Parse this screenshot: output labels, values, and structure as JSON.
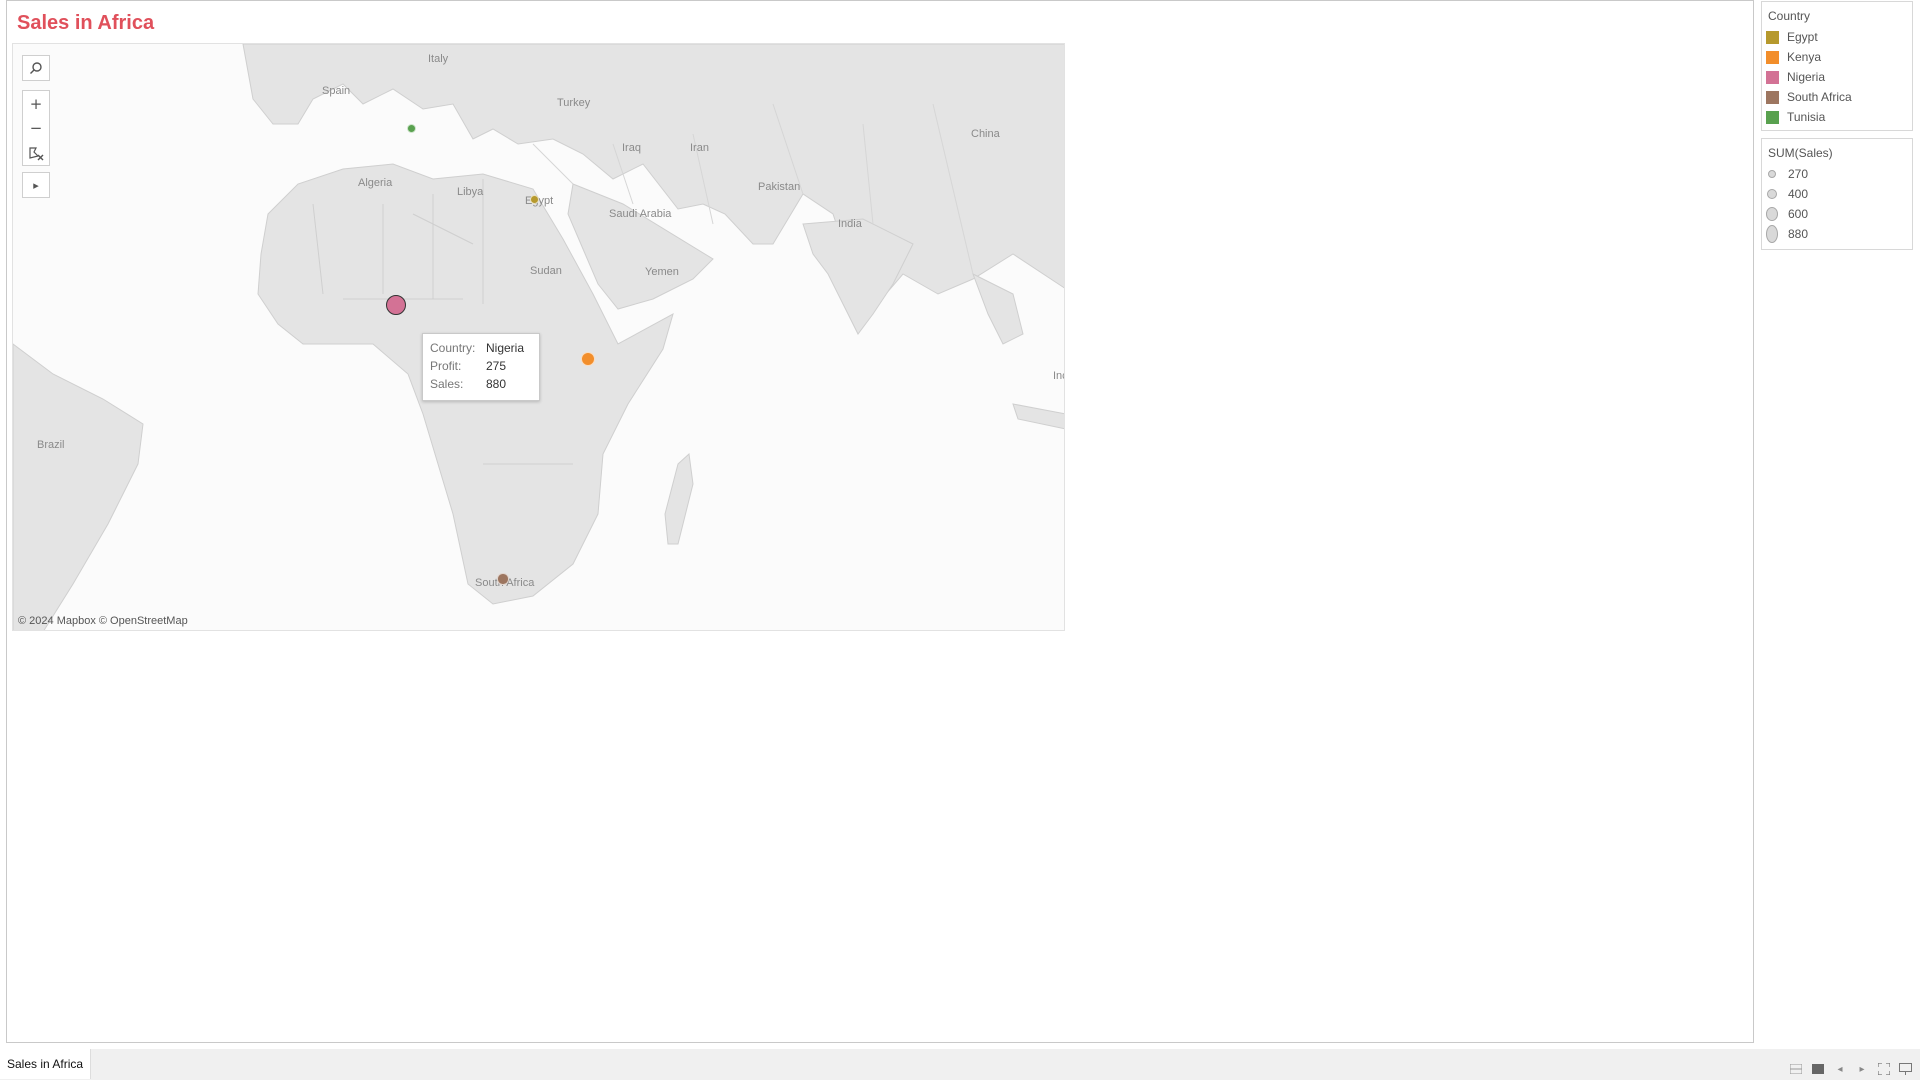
{
  "dashboard": {
    "title": "Sales in Africa",
    "title_color": "#e0505b"
  },
  "map": {
    "labels": {
      "italy": "Italy",
      "spain": "Spain",
      "turkey": "Turkey",
      "iraq": "Iraq",
      "iran": "Iran",
      "china": "China",
      "algeria": "Algeria",
      "libya": "Libya",
      "egypt": "Egypt",
      "pakistan": "Pakistan",
      "saudi_arabia": "Saudi Arabia",
      "india": "India",
      "sudan": "Sudan",
      "yemen": "Yemen",
      "brazil": "Brazil",
      "south_africa": "South Africa",
      "indonesia_partial": "Inc"
    },
    "attribution": "© 2024 Mapbox © OpenStreetMap",
    "tools": {
      "search": "search-icon",
      "zoom_in": "+",
      "zoom_out": "−",
      "pan": "▸"
    },
    "marks": [
      {
        "country": "Tunisia",
        "color": "#59a14f",
        "sales": 270
      },
      {
        "country": "Egypt",
        "color": "#b6992d",
        "sales": 270
      },
      {
        "country": "Nigeria",
        "color": "#d37295",
        "sales": 880
      },
      {
        "country": "Kenya",
        "color": "#f28e2b",
        "sales": 600
      },
      {
        "country": "South Africa",
        "color": "#9d7660",
        "sales": 400
      }
    ],
    "tooltip": {
      "country_key": "Country:",
      "country_val": "Nigeria",
      "profit_key": "Profit:",
      "profit_val": "275",
      "sales_key": "Sales:",
      "sales_val": "880"
    }
  },
  "legend_color": {
    "title": "Country",
    "items": [
      {
        "label": "Egypt",
        "color": "#b6992d"
      },
      {
        "label": "Kenya",
        "color": "#f28e2b"
      },
      {
        "label": "Nigeria",
        "color": "#d37295"
      },
      {
        "label": "South Africa",
        "color": "#9d7660"
      },
      {
        "label": "Tunisia",
        "color": "#59a14f"
      }
    ]
  },
  "legend_size": {
    "title": "SUM(Sales)",
    "items": [
      {
        "label": "270"
      },
      {
        "label": "400"
      },
      {
        "label": "600"
      },
      {
        "label": "880"
      }
    ]
  },
  "tabs": [
    {
      "label": "Sales in Africa"
    }
  ]
}
